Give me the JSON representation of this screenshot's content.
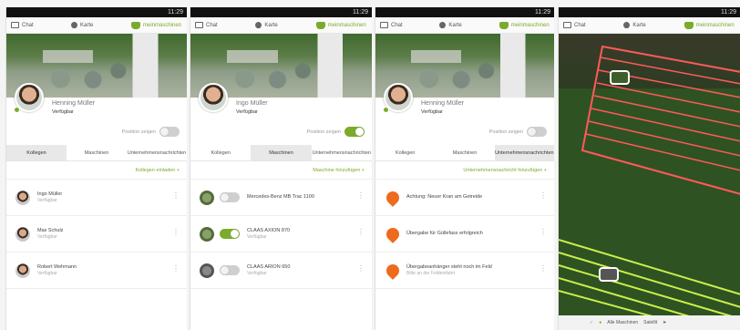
{
  "status_time": "11:29",
  "topbar": {
    "chat": "Chat",
    "map": "Karte",
    "machines": "meinmaschinen"
  },
  "screen1": {
    "profile_name": "Henning Müller",
    "profile_status": "Verfügbar",
    "position_label": "Position zeigen",
    "tabs": [
      "Kollegen",
      "Maschinen",
      "Unternehmensnachrichten"
    ],
    "add_link": "Kollegen einladen +",
    "items": [
      {
        "name": "Ingo Müller",
        "sub": "Verfügbar"
      },
      {
        "name": "Max Schulz",
        "sub": "Verfügbar"
      },
      {
        "name": "Robert Wehmann",
        "sub": "Verfügbar"
      }
    ]
  },
  "screen2": {
    "profile_name": "Ingo Müller",
    "profile_status": "Verfügbar",
    "position_label": "Position zeigen",
    "tabs": [
      "Kollegen",
      "Maschinen",
      "Unternehmensnachrichten"
    ],
    "add_link": "Maschine hinzufügen +",
    "items": [
      {
        "name": "Mercedes-Benz MB Trac 1100",
        "sub": "",
        "toggle": false
      },
      {
        "name": "CLAAS AXION 870",
        "sub": "Verfügbar",
        "toggle": true
      },
      {
        "name": "CLAAS ARION 650",
        "sub": "Verfügbar",
        "toggle": false
      }
    ]
  },
  "screen3": {
    "profile_name": "Henning Müller",
    "profile_status": "Verfügbar",
    "position_label": "Position zeigen",
    "tabs": [
      "Kollegen",
      "Maschinen",
      "Unternehmensnachrichten"
    ],
    "add_link": "Unternehmensnachricht hinzufügen +",
    "items": [
      {
        "title": "Achtung: Neuer Kran am Getreide",
        "sub": ""
      },
      {
        "title": "Übergabe für Güllefass erfolgreich",
        "sub": ""
      },
      {
        "title": "Übergabeanhänger steht noch im Feld",
        "sub": "Bitte an der Feldeinfahrt"
      }
    ]
  },
  "screen4": {
    "mapbar_label": "Alle Maschinen",
    "mapbar_mode": "Satellit"
  },
  "colors": {
    "accent": "#7bab2a",
    "orange": "#ee6a1c",
    "field_line_red": "#ff5a5a",
    "field_line_green": "#c8f04a"
  }
}
